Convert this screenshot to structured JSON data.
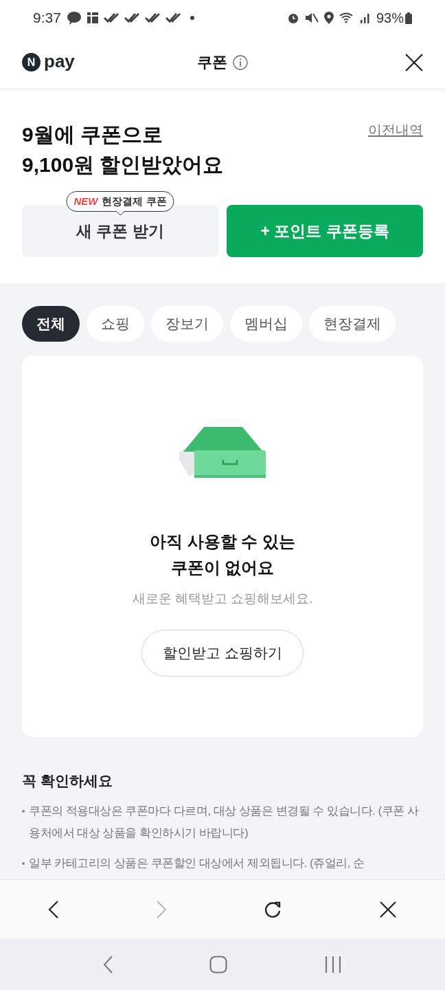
{
  "status_bar": {
    "time": "9:37",
    "battery": "93%"
  },
  "header": {
    "logo_mark": "N",
    "logo_text": "pay",
    "title": "쿠폰"
  },
  "summary": {
    "headline": "9월에 쿠폰으로\n9,100원 할인받았어요",
    "history_link": "이전내역"
  },
  "actions": [
    {
      "kind": "secondary",
      "label": "새 쿠폰 받기",
      "tooltip_new": "NEW",
      "tooltip_text": "현장결제 쿠폰"
    },
    {
      "kind": "primary",
      "label": "+ 포인트 쿠폰등록"
    }
  ],
  "tabs": [
    {
      "label": "전체",
      "selected": true
    },
    {
      "label": "쇼핑",
      "selected": false
    },
    {
      "label": "장보기",
      "selected": false
    },
    {
      "label": "멤버십",
      "selected": false
    },
    {
      "label": "현장결제",
      "selected": false
    }
  ],
  "empty_state": {
    "title": "아직 사용할 수 있는\n쿠폰이 없어요",
    "subtitle": "새로운 혜택받고 쇼핑해보세요.",
    "button": "할인받고 쇼핑하기"
  },
  "notice": {
    "title": "꼭 확인하세요",
    "items": [
      "쿠폰의 적용대상은 쿠폰마다 다르며, 대상 상품은 변경될 수 있습니다. (쿠폰 사용처에서 대상 상품을 확인하시기 바랍니다)",
      "일부 카테고리의 상품은 쿠폰할인 대상에서 제외됩니다. (쥬얼리, 순"
    ]
  },
  "browser_toolbar": {
    "back_enabled": true,
    "forward_enabled": false
  }
}
